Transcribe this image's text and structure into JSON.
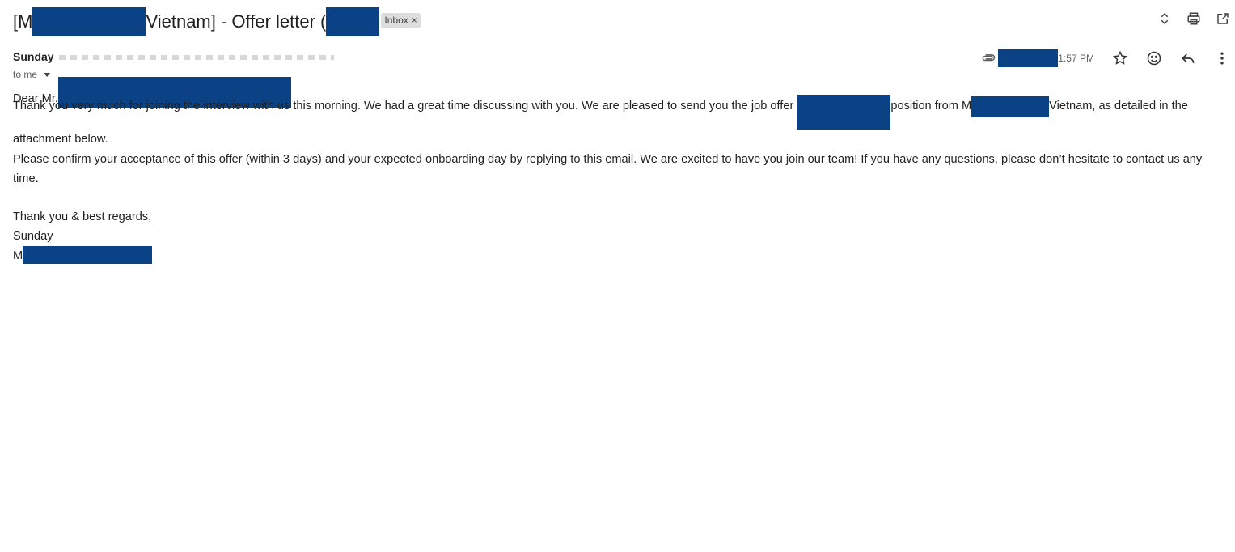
{
  "subject": {
    "prefix": "[M",
    "middle": "Vietnam] - Offer letter (",
    "label_chip": "Inbox",
    "chip_close": "×"
  },
  "toolbar": {
    "icons": [
      "expand-collapse-icon",
      "print-icon",
      "open-new-window-icon"
    ]
  },
  "message": {
    "sender_name": "Sunday",
    "to_label": "to me",
    "time": "1:57 PM",
    "actions": [
      "star-icon",
      "emoji-reaction-icon",
      "reply-icon",
      "more-options-icon"
    ]
  },
  "body": {
    "greeting": "Dear Mr.",
    "p1_part1": "Thank you very much for joining the interview with us this morning. We had a great time discussing with you. We are pleased to send you the job offer",
    "p1_part2": "position from M",
    "p1_part3": "Vietnam, as detailed in the attachment below.",
    "p2": "Please confirm your acceptance of this offer (within 3 days) and your expected onboarding day by replying to this email. We are excited to have you join our team! If you have any questions, please don’t hesitate to contact us any time.",
    "closing": "Thank you & best regards,",
    "signature_name": "Sunday",
    "signature_company_prefix": "M"
  },
  "colors": {
    "redaction": "#0b4185",
    "chip_bg": "#dddddd",
    "text": "#1f1f1f"
  }
}
